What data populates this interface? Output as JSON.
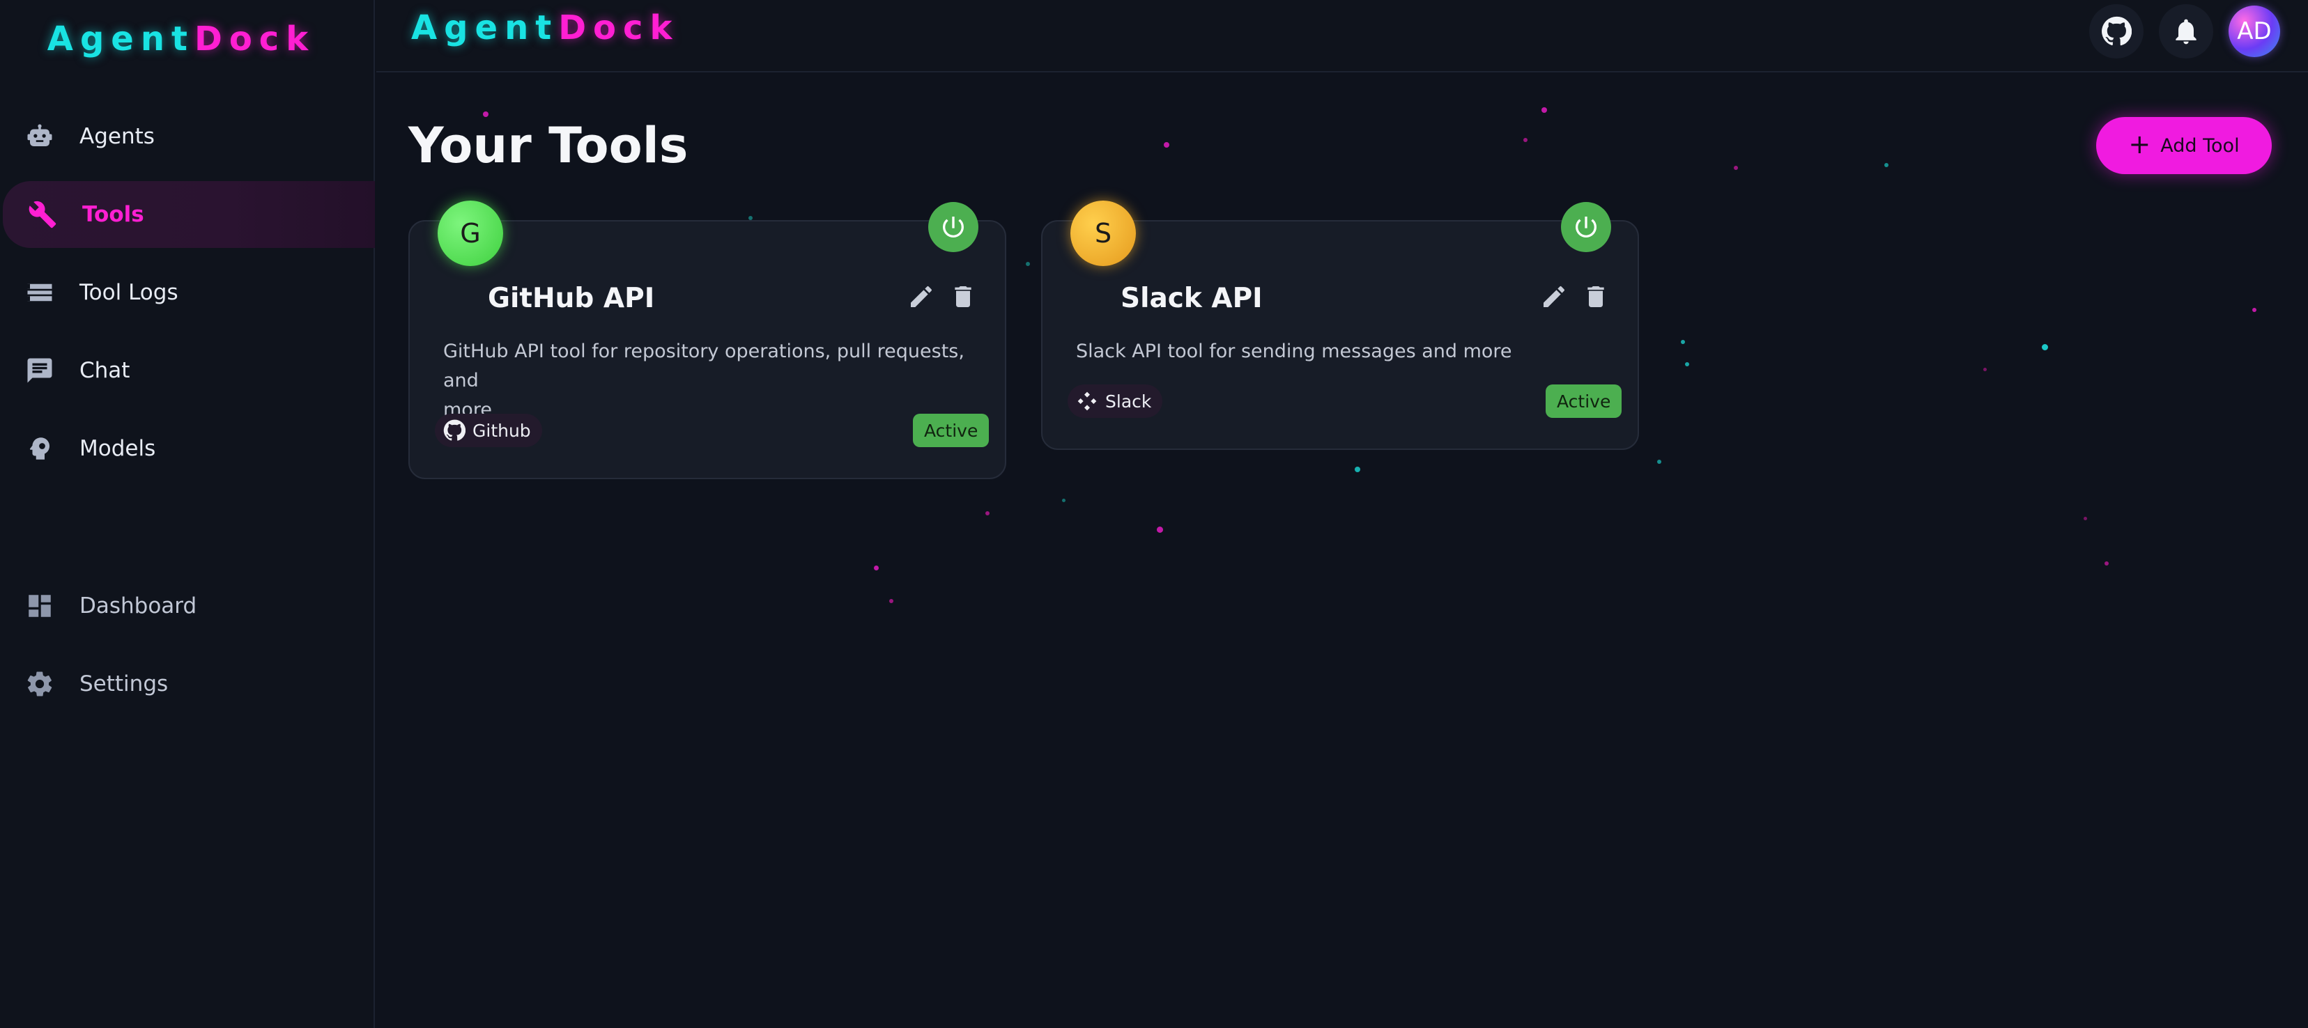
{
  "brand": {
    "part1": "Agent",
    "part2": "Dock"
  },
  "sidebar": {
    "items": [
      {
        "label": "Agents",
        "icon": "robot-icon"
      },
      {
        "label": "Tools",
        "icon": "wrench-icon",
        "active": true
      },
      {
        "label": "Tool Logs",
        "icon": "list-icon"
      },
      {
        "label": "Chat",
        "icon": "chat-icon"
      },
      {
        "label": "Models",
        "icon": "brain-icon"
      }
    ],
    "bottom_items": [
      {
        "label": "Dashboard",
        "icon": "dashboard-icon"
      },
      {
        "label": "Settings",
        "icon": "gear-icon"
      }
    ]
  },
  "header": {
    "avatar_initials": "AD",
    "icons": [
      "github-icon",
      "bell-icon"
    ]
  },
  "main": {
    "title": "Your Tools",
    "add_button_label": "Add Tool"
  },
  "tools": [
    {
      "initial": "G",
      "name": "GitHub API",
      "description_line1": "GitHub API tool for repository operations, pull requests, and",
      "description_line2": "more",
      "category": "Github",
      "status": "Active",
      "color": "#4ede4e"
    },
    {
      "initial": "S",
      "name": "Slack API",
      "description_line1": "Slack API tool for sending messages and more",
      "category": "Slack",
      "status": "Active",
      "color": "#f0b02a"
    }
  ],
  "colors": {
    "accent": "#ff1fd2",
    "cyan": "#19e3e3",
    "success": "#4caf50"
  }
}
